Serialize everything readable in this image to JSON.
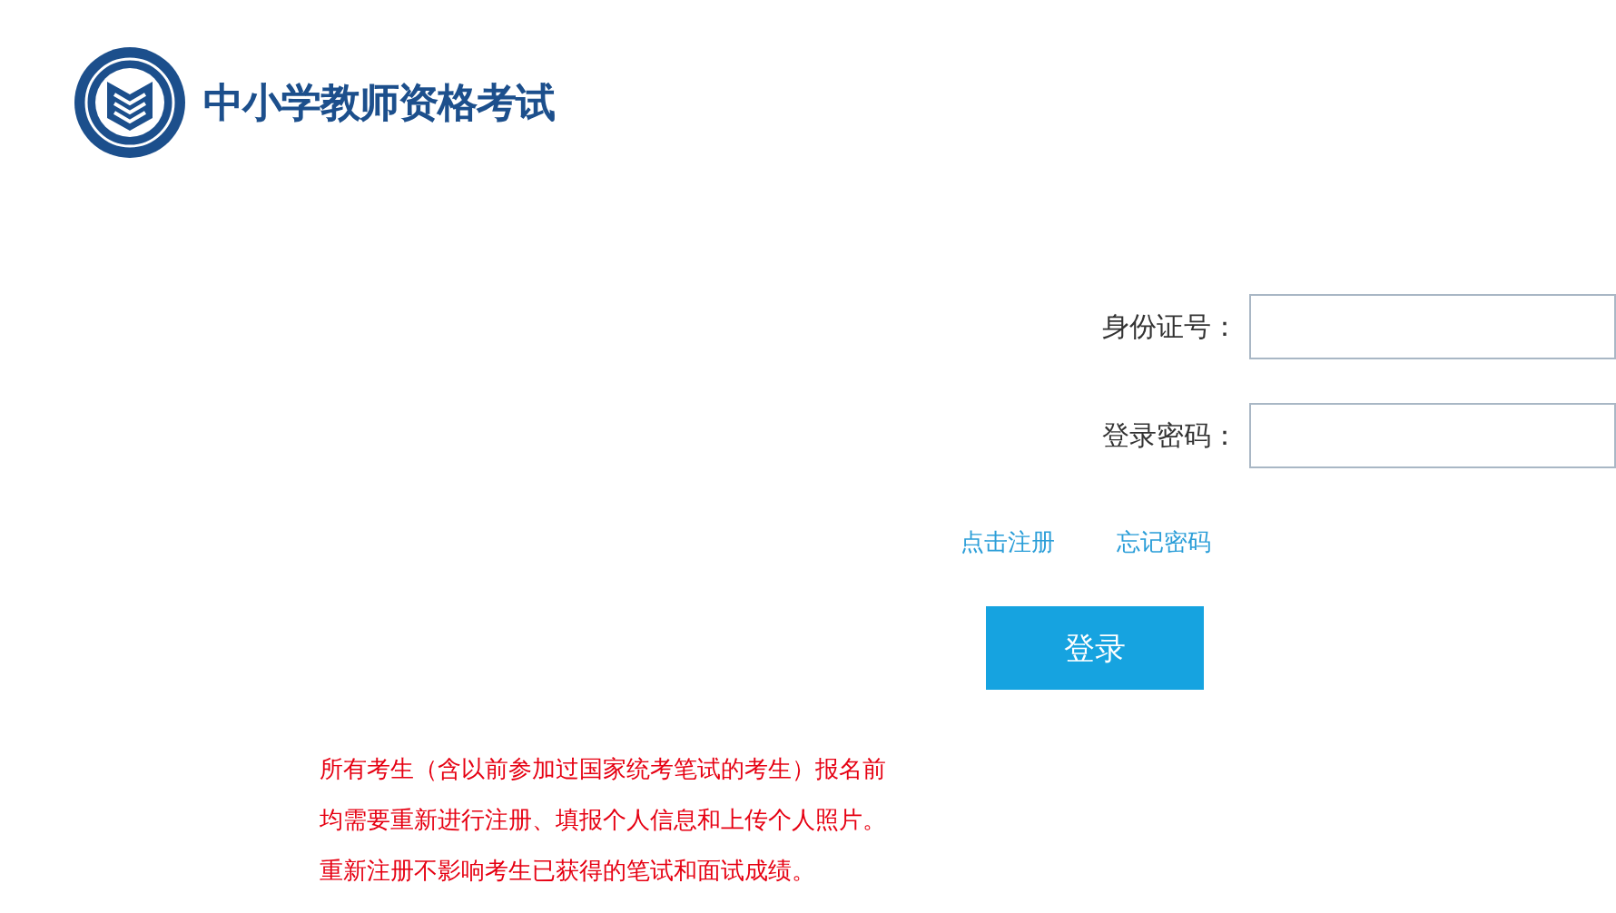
{
  "header": {
    "title": "中小学教师资格考试"
  },
  "form": {
    "fields": [
      {
        "label": "身份证号："
      },
      {
        "label": "登录密码："
      }
    ],
    "links": [
      "点击注册",
      "忘记密码"
    ],
    "submit": "登录"
  },
  "notice": [
    "所有考生（含以前参加过国家统考笔试的考生）报名前",
    "均需要重新进行注册、填报个人信息和上传个人照片。",
    "重新注册不影响考生已获得的笔试和面试成绩。"
  ]
}
